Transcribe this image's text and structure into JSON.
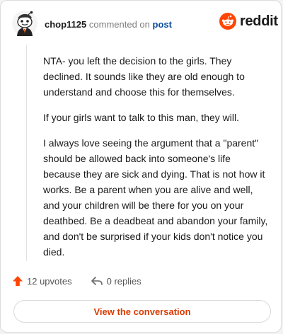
{
  "header": {
    "username": "chop1125",
    "action": "commented on",
    "post_link": "post"
  },
  "brand": {
    "word": "reddit",
    "color": "#ff4500"
  },
  "comment": {
    "paragraphs": [
      "NTA- you left the decision to the girls. They declined. It sounds like they are old enough to understand and choose this for themselves.",
      "If your girls want to talk to this man, they will.",
      "I always love seeing the argument that a \"parent\" should be allowed back into someone's life because they are sick and dying. That is not how it works. Be a parent when you are alive and well, and your children will be there for you on your deathbed. Be a deadbeat and abandon your family, and don't be surprised if your kids don't notice you died."
    ]
  },
  "actions": {
    "upvotes": "12 upvotes",
    "replies": "0 replies",
    "upvote_icon": "arrow-up-icon",
    "reply_icon": "reply-arrow-icon",
    "upvote_color": "#ff4500"
  },
  "cta": {
    "label": "View the conversation"
  }
}
